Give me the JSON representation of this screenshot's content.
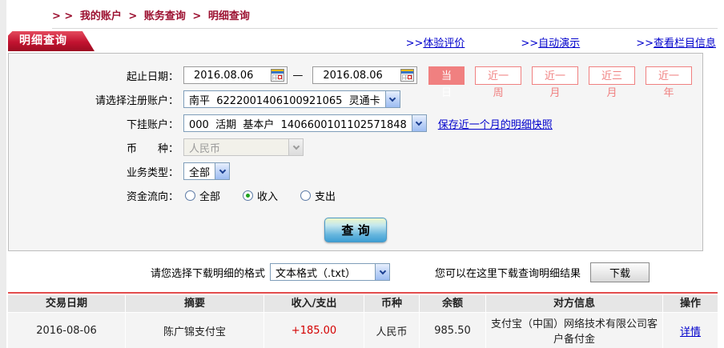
{
  "breadcrumb": {
    "prefix": "> >",
    "separator": ">",
    "items": [
      "我的账户",
      "账务查询",
      "明细查询"
    ]
  },
  "panel": {
    "title": "明细查询",
    "links": [
      {
        "prefix": ">>",
        "label": "体验评价"
      },
      {
        "prefix": ">>",
        "label": "自动演示"
      },
      {
        "prefix": ">>",
        "label": "查看栏目信息"
      }
    ]
  },
  "form": {
    "date_label": "起止日期：",
    "date_from": "2016.08.06",
    "date_to": "2016.08.06",
    "date_separator": "—",
    "range_buttons": [
      {
        "label": "当日",
        "active": true
      },
      {
        "label": "近一周",
        "active": false
      },
      {
        "label": "近一月",
        "active": false
      },
      {
        "label": "近三月",
        "active": false
      },
      {
        "label": "近一年",
        "active": false
      }
    ],
    "register_account": {
      "label": "请选择注册账户：",
      "value": "南平  6222001406100921065  灵通卡"
    },
    "sub_account": {
      "label": "下挂账户：",
      "value": "000  活期  基本户  1406600101102571848",
      "link": "保存近一个月的明细快照"
    },
    "currency": {
      "label": "币　　种：",
      "value": "人民币",
      "disabled": true
    },
    "biz_type": {
      "label": "业务类型：",
      "value": "全部"
    },
    "fund_flow": {
      "label": "资金流向：",
      "options": [
        {
          "label": "全部",
          "checked": false
        },
        {
          "label": "收入",
          "checked": true
        },
        {
          "label": "支出",
          "checked": false
        }
      ]
    },
    "query_button": "查 询"
  },
  "download": {
    "format_label": "请您选择下载明细的格式",
    "format_value": "文本格式（.txt）",
    "hint": "您可以在这里下载查询明细结果",
    "button": "下载"
  },
  "table": {
    "headers": [
      "交易日期",
      "摘要",
      "收入/支出",
      "币种",
      "余额",
      "对方信息",
      "操作"
    ],
    "rows": [
      {
        "date": "2016-08-06",
        "summary": "陈广锦支付宝",
        "amount": "+185.00",
        "currency": "人民币",
        "balance": "985.50",
        "counterparty": "支付宝（中国）网络技术有限公司客户备付金",
        "action": "详情"
      }
    ]
  },
  "colors": {
    "brand_red": "#9c1131",
    "tab_red": "#c21330",
    "salmon": "#f08080",
    "link_blue": "#0000cc",
    "amount_red": "#d40000",
    "divider_red": "#e34d4d"
  }
}
